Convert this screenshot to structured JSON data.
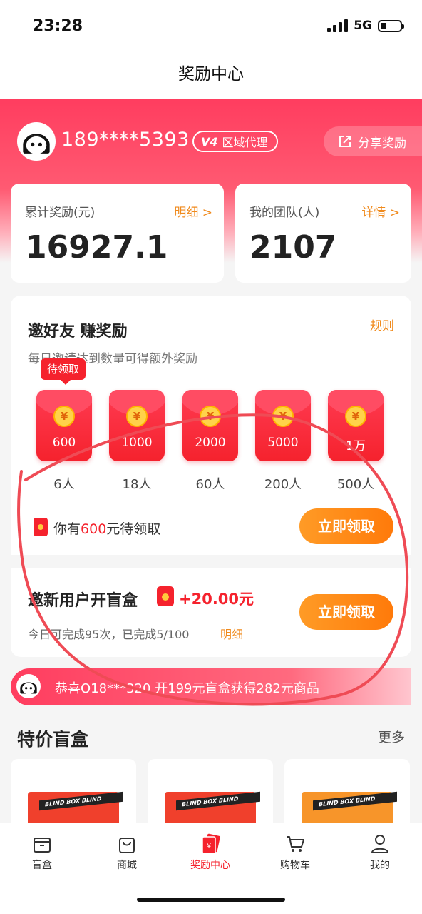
{
  "status": {
    "time": "23:28",
    "network": "5G"
  },
  "nav": {
    "title": "奖励中心"
  },
  "user": {
    "phone": "189****5393",
    "level": "V4",
    "role": "区域代理",
    "share_label": "分享奖励"
  },
  "stats": {
    "total_reward": {
      "label": "累计奖励(元)",
      "link": "明细 >",
      "value": "16927.1"
    },
    "team": {
      "label": "我的团队(人)",
      "link": "详情 >",
      "value": "2107"
    }
  },
  "invite": {
    "title": "邀好友 赚奖励",
    "rules": "规则",
    "subtitle": "每日邀请达到数量可得额外奖励",
    "pending_tag": "待领取",
    "coin_symbol": "¥",
    "tiers": [
      {
        "amount": "600",
        "people": "6人"
      },
      {
        "amount": "1000",
        "people": "18人"
      },
      {
        "amount": "2000",
        "people": "60人"
      },
      {
        "amount": "5000",
        "people": "200人"
      },
      {
        "amount": "1万",
        "people": "500人"
      }
    ],
    "pending_prefix": "你有",
    "pending_amount": "600",
    "pending_suffix": "元待领取",
    "claim_label": "立即领取"
  },
  "task": {
    "title": "邀新用户开盲盒",
    "reward": "+20.00元",
    "progress": "今日可完成95次，已完成5/100",
    "link": "明细",
    "claim_label": "立即领取"
  },
  "ticker": {
    "text": "恭喜O18***320 开199元盲盒获得282元商品"
  },
  "section": {
    "title": "特价盲盒",
    "more": "更多"
  },
  "products": [
    {
      "band": "BLIND BOX BLIND",
      "color": "#f0402c"
    },
    {
      "band": "BLIND BOX BLIND",
      "color": "#f0402c"
    },
    {
      "band": "BLIND BOX BLIND",
      "color": "#f7952a"
    }
  ],
  "tabs": [
    {
      "label": "盲盒",
      "icon": "box-icon"
    },
    {
      "label": "商城",
      "icon": "shopping-bag-icon"
    },
    {
      "label": "奖励中心",
      "icon": "reward-icon",
      "active": true
    },
    {
      "label": "购物车",
      "icon": "cart-icon"
    },
    {
      "label": "我的",
      "icon": "profile-icon"
    }
  ],
  "colors": {
    "primary": "#ff3d5f",
    "accent": "#f5222d",
    "orange": "#ff8a1a",
    "link": "#f08a1c"
  }
}
